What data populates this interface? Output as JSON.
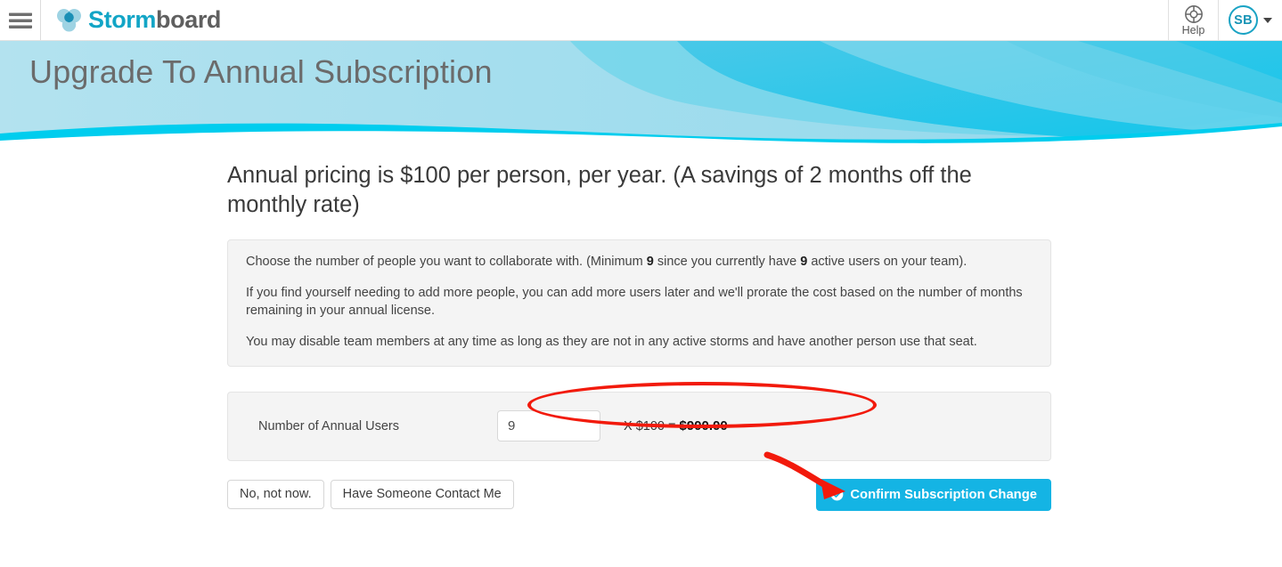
{
  "topnav": {
    "menu_icon": "hamburger-icon",
    "brand": {
      "part1": "Storm",
      "part2": "board",
      "logo_icon": "stormboard-logo-icon"
    },
    "help": {
      "label": "Help",
      "icon": "lifebuoy-icon"
    },
    "avatar": {
      "initials": "SB",
      "caret_icon": "chevron-down-icon"
    }
  },
  "banner": {
    "title": "Upgrade To Annual Subscription"
  },
  "main": {
    "headline": "Annual pricing is $100 per person, per year. (A savings of 2 months off the monthly rate)",
    "info_panel": {
      "para1_a": "Choose the number of people you want to collaborate with. (Minimum ",
      "para1_min": "9",
      "para1_b": " since you currently have ",
      "para1_active": "9",
      "para1_c": " active users on your team).",
      "para2": "If you find yourself needing to add more people, you can add more users later and we'll prorate the cost based on the number of months remaining in your annual license.",
      "para3": "You may disable team members at any time as long as they are not in any active storms and have another person use that seat."
    },
    "users_row": {
      "label": "Number of Annual Users",
      "quantity_value": "9",
      "quantity_placeholder": "",
      "multiplier_prefix": "X $100 = ",
      "total": "$900.00"
    },
    "actions": {
      "decline_label": "No, not now.",
      "contact_label": "Have Someone Contact Me",
      "confirm_label": "Confirm Subscription Change",
      "confirm_icon": "circle-check-icon"
    }
  },
  "annotations": {
    "ellipse": "red-ellipse-highlight",
    "arrow": "red-arrow-pointer"
  },
  "colors": {
    "accent": "#14b4e4",
    "brand_teal": "#12a5c6",
    "annotation_red": "#f21a0c",
    "panel_bg": "#f4f4f4"
  }
}
